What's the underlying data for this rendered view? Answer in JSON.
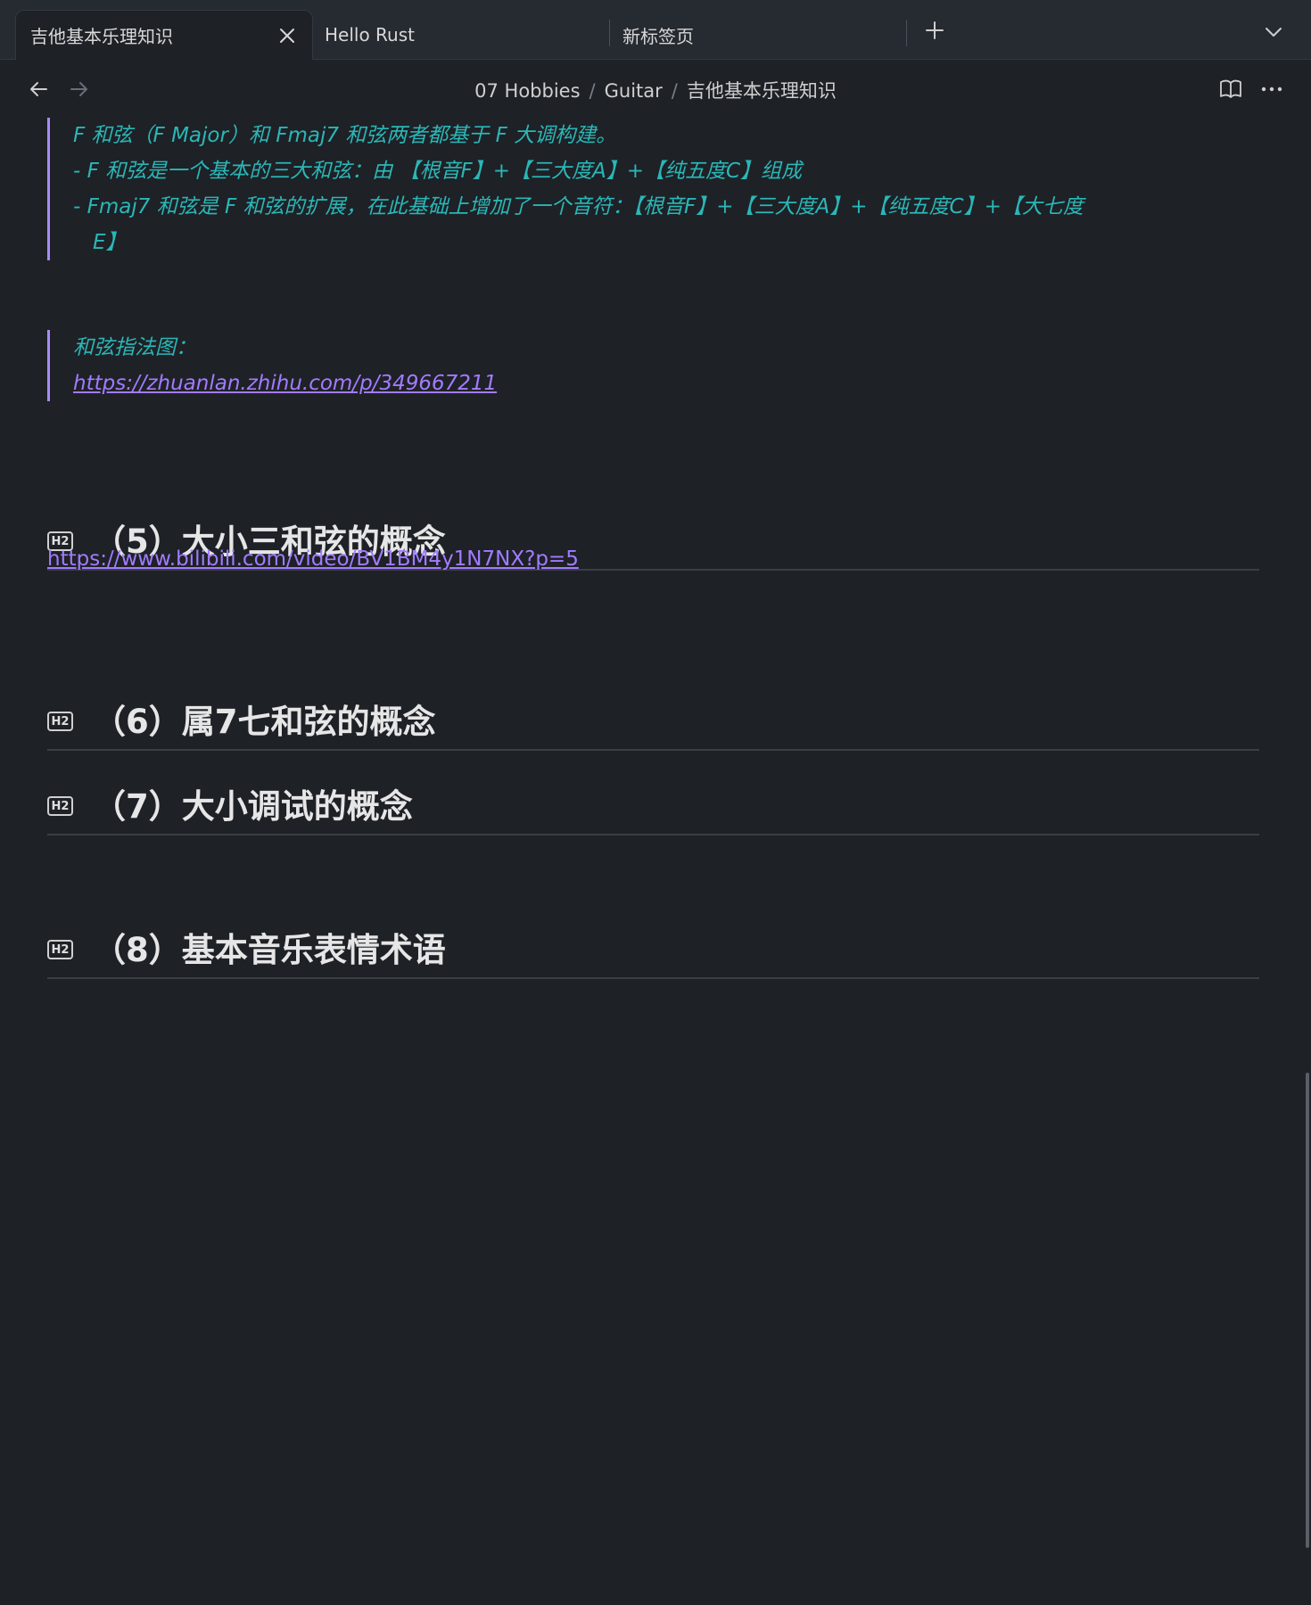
{
  "tabs": [
    {
      "label": "吉他基本乐理知识",
      "active": true
    },
    {
      "label": "Hello Rust",
      "active": false
    },
    {
      "label": "新标签页",
      "active": false
    }
  ],
  "breadcrumb": [
    "07 Hobbies",
    "Guitar",
    "吉他基本乐理知识"
  ],
  "callout1": {
    "lines": [
      "F 和弦（F Major）和 Fmaj7 和弦两者都基于 F 大调构建。",
      "- F 和弦是一个基本的三大和弦：由 【根音F】+【三大度A】+【纯五度C】组成",
      "- Fmaj7 和弦是 F 和弦的扩展，在此基础上增加了一个音符：【根音F】+【三大度A】+【纯五度C】+【大七度",
      "E】"
    ]
  },
  "callout2": {
    "label": "和弦指法图：",
    "link": "https://zhuanlan.zhihu.com/p/349667211"
  },
  "headings": [
    {
      "badge": "H2",
      "text": "（5）大小三和弦的概念"
    },
    {
      "badge": "H2",
      "text": "（6）属7七和弦的概念"
    },
    {
      "badge": "H2",
      "text": "（7）大小调试的概念"
    },
    {
      "badge": "H2",
      "text": "（8）基本音乐表情术语"
    }
  ],
  "links": {
    "bilibili": "https://www.bilibili.com/video/BV1BM4y1N7NX?p=5"
  },
  "colors": {
    "background": "#1e2126",
    "callout_text": "#2ab7b7",
    "callout_border": "#a78bfa",
    "link": "#a27bff"
  }
}
